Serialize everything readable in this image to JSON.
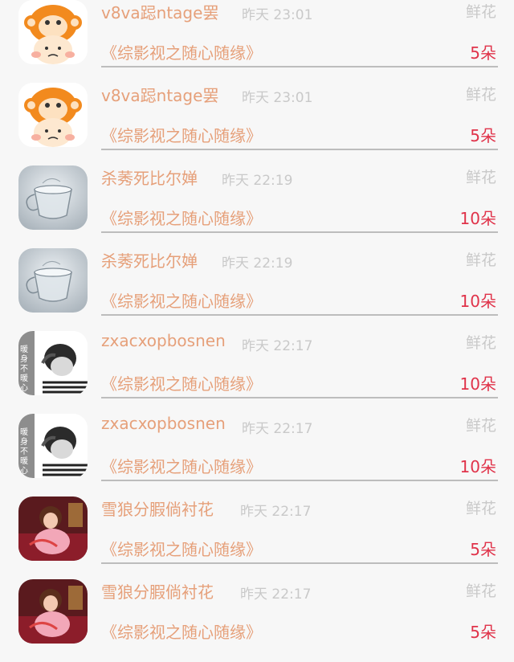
{
  "items": [
    {
      "avatar": "monkey-avatar-icon",
      "name": "v8va跽ntage罢",
      "time": "昨天 23:01",
      "gift": "鲜花",
      "book": "《综影视之随心随缘》",
      "count": "5朵"
    },
    {
      "avatar": "monkey-avatar-icon",
      "name": "v8va跽ntage罢",
      "time": "昨天 23:01",
      "gift": "鲜花",
      "book": "《综影视之随心随缘》",
      "count": "5朵"
    },
    {
      "avatar": "glass-cup-avatar-icon",
      "name": "杀莠死比尔婵",
      "time": "昨天 22:19",
      "gift": "鲜花",
      "book": "《综影视之随心随缘》",
      "count": "10朵"
    },
    {
      "avatar": "glass-cup-avatar-icon",
      "name": "杀莠死比尔婵",
      "time": "昨天 22:19",
      "gift": "鲜花",
      "book": "《综影视之随心随缘》",
      "count": "10朵"
    },
    {
      "avatar": "boy-portrait-avatar-icon",
      "name": "zxacxopbosnen",
      "time": "昨天 22:17",
      "gift": "鲜花",
      "book": "《综影视之随心随缘》",
      "count": "10朵"
    },
    {
      "avatar": "boy-portrait-avatar-icon",
      "name": "zxacxopbosnen",
      "time": "昨天 22:17",
      "gift": "鲜花",
      "book": "《综影视之随心随缘》",
      "count": "10朵"
    },
    {
      "avatar": "anime-girl-avatar-icon",
      "name": "雪狼分腵倘衬花",
      "time": "昨天 22:17",
      "gift": "鲜花",
      "book": "《综影视之随心随缘》",
      "count": "5朵"
    },
    {
      "avatar": "anime-girl-avatar-icon",
      "name": "雪狼分腵倘衬花",
      "time": "昨天 22:17",
      "gift": "鲜花",
      "book": "《综影视之随心随缘》",
      "count": "5朵"
    }
  ],
  "avatar_text": "暖身不暖心",
  "colors": {
    "name": "#e6a07a",
    "count": "#e0334a",
    "muted": "#c9c9c9",
    "background": "#f7f7f7"
  }
}
